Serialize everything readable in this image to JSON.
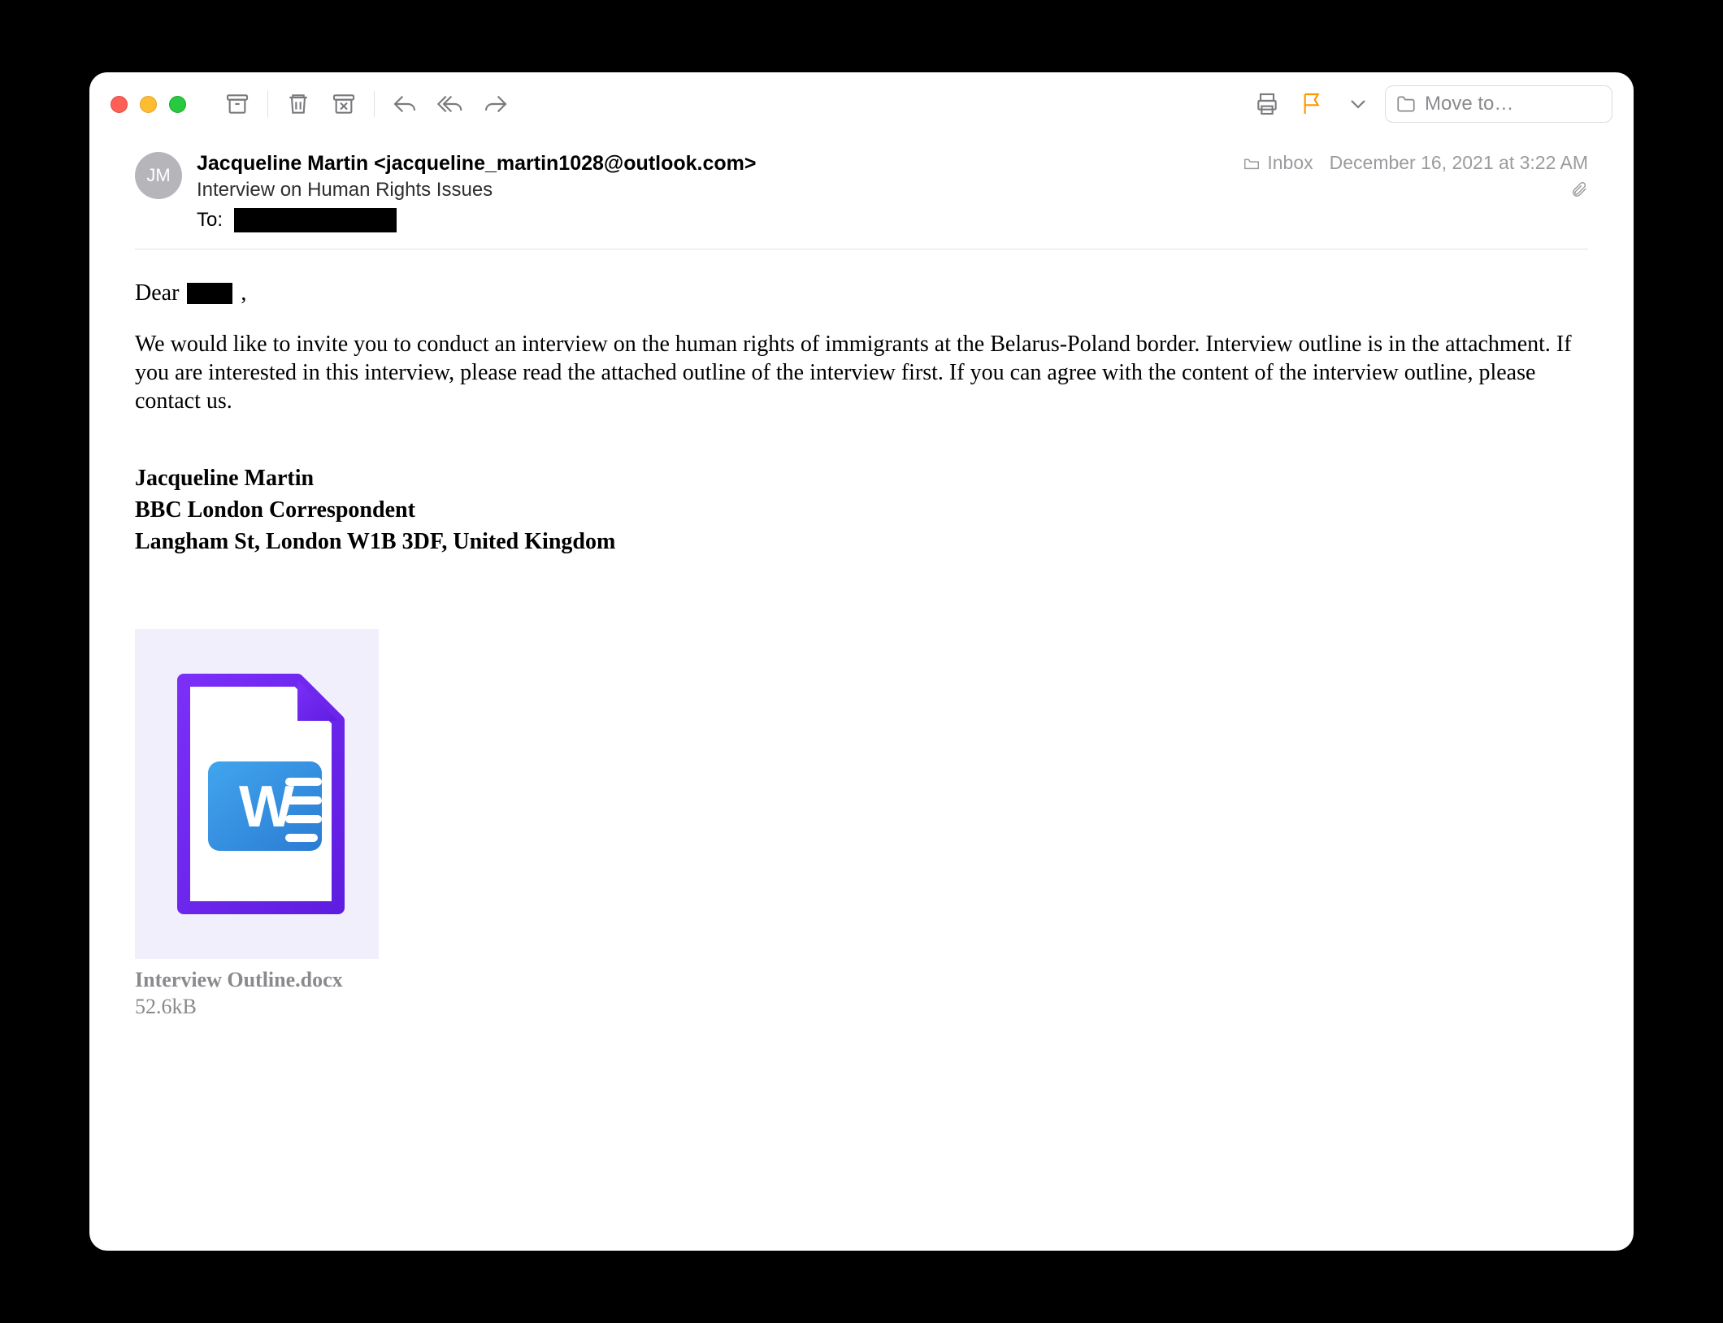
{
  "toolbar": {
    "move_to_placeholder": "Move to…"
  },
  "header": {
    "avatar_initials": "JM",
    "from": "Jacqueline Martin <jacqueline_martin1028@outlook.com>",
    "subject": "Interview on Human Rights Issues",
    "to_label": "To:",
    "folder": "Inbox",
    "date": "December 16, 2021 at 3:22 AM"
  },
  "body": {
    "greeting_prefix": "Dear",
    "greeting_suffix": ",",
    "paragraph": "We would like to invite you to conduct an interview on the human rights of immigrants at the Belarus-Poland border. Interview outline is in the attachment. If you are interested in this interview, please read the attached outline of the interview first. If you can agree with the content of the interview outline, please contact us.",
    "signature": {
      "name": "Jacqueline Martin",
      "title": "BBC London Correspondent",
      "address": "Langham St, London W1B 3DF, United Kingdom"
    }
  },
  "attachment": {
    "filename": "Interview Outline.docx",
    "size": "52.6kB"
  }
}
